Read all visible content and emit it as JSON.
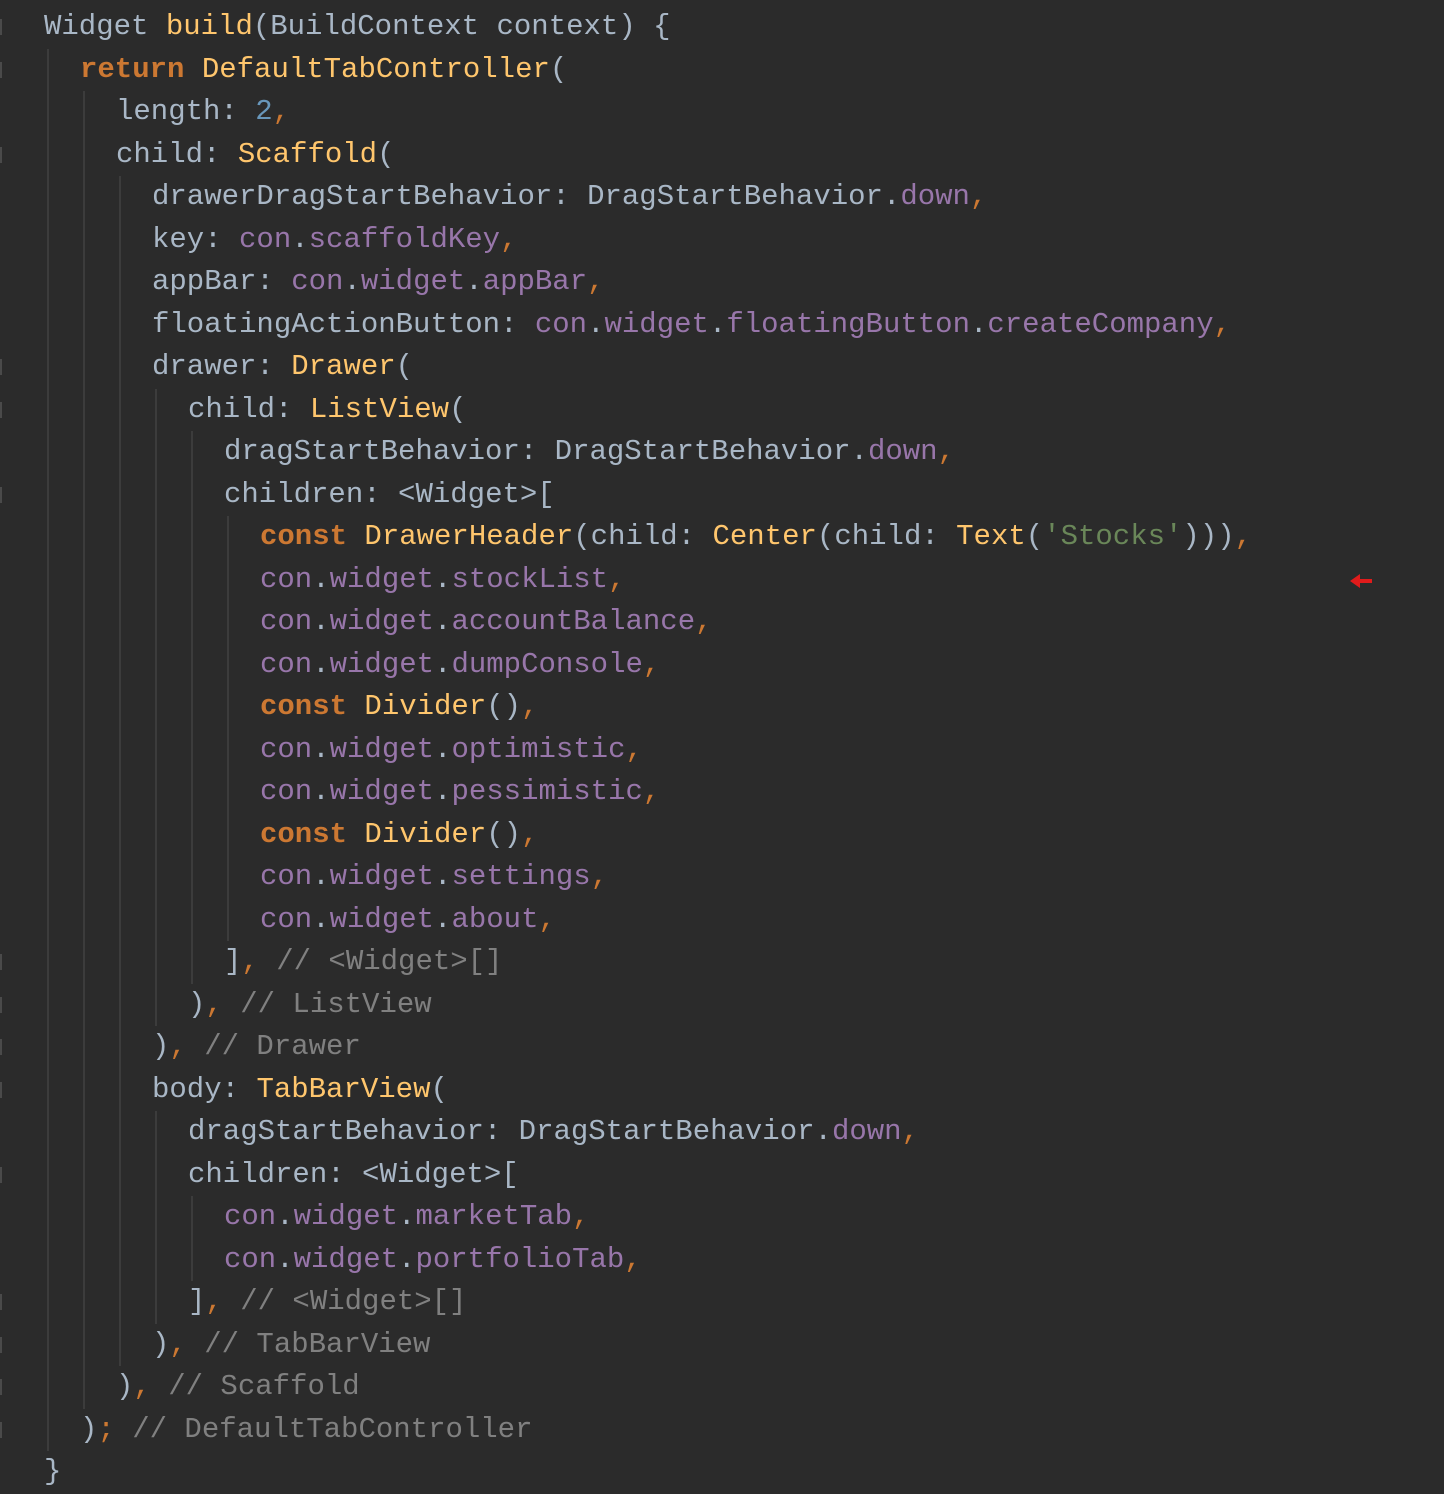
{
  "editor": {
    "language": "Dart",
    "theme_colors": {
      "background": "#2b2b2b",
      "keyword": "#cc7832",
      "function": "#ffc66d",
      "identifier": "#a9b7c6",
      "property": "#9876aa",
      "number": "#6897bb",
      "string": "#6a8759",
      "comment": "#808080"
    },
    "lines": [
      {
        "indent": 0,
        "tokens": [
          [
            "id",
            "Widget "
          ],
          [
            "fn",
            "build"
          ],
          [
            "punc",
            "("
          ],
          [
            "id",
            "BuildContext context"
          ],
          [
            "punc",
            ") {"
          ]
        ]
      },
      {
        "indent": 1,
        "tokens": [
          [
            "kw",
            "return "
          ],
          [
            "fn",
            "DefaultTabController"
          ],
          [
            "punc",
            "("
          ]
        ]
      },
      {
        "indent": 2,
        "tokens": [
          [
            "id",
            "length"
          ],
          [
            "punc",
            ": "
          ],
          [
            "num",
            "2"
          ],
          [
            "comma",
            ","
          ]
        ]
      },
      {
        "indent": 2,
        "tokens": [
          [
            "id",
            "child"
          ],
          [
            "punc",
            ": "
          ],
          [
            "fn",
            "Scaffold"
          ],
          [
            "punc",
            "("
          ]
        ]
      },
      {
        "indent": 3,
        "tokens": [
          [
            "id",
            "drawerDragStartBehavior"
          ],
          [
            "punc",
            ": "
          ],
          [
            "id",
            "DragStartBehavior"
          ],
          [
            "punc",
            "."
          ],
          [
            "prop",
            "down"
          ],
          [
            "comma",
            ","
          ]
        ]
      },
      {
        "indent": 3,
        "tokens": [
          [
            "id",
            "key"
          ],
          [
            "punc",
            ": "
          ],
          [
            "prop",
            "con"
          ],
          [
            "punc",
            "."
          ],
          [
            "prop",
            "scaffoldKey"
          ],
          [
            "comma",
            ","
          ]
        ]
      },
      {
        "indent": 3,
        "tokens": [
          [
            "id",
            "appBar"
          ],
          [
            "punc",
            ": "
          ],
          [
            "prop",
            "con"
          ],
          [
            "punc",
            "."
          ],
          [
            "prop",
            "widget"
          ],
          [
            "punc",
            "."
          ],
          [
            "prop",
            "appBar"
          ],
          [
            "comma",
            ","
          ]
        ]
      },
      {
        "indent": 3,
        "tokens": [
          [
            "id",
            "floatingActionButton"
          ],
          [
            "punc",
            ": "
          ],
          [
            "prop",
            "con"
          ],
          [
            "punc",
            "."
          ],
          [
            "prop",
            "widget"
          ],
          [
            "punc",
            "."
          ],
          [
            "prop",
            "floatingButton"
          ],
          [
            "punc",
            "."
          ],
          [
            "prop",
            "createCompany"
          ],
          [
            "comma",
            ","
          ]
        ]
      },
      {
        "indent": 3,
        "tokens": [
          [
            "id",
            "drawer"
          ],
          [
            "punc",
            ": "
          ],
          [
            "fn",
            "Drawer"
          ],
          [
            "punc",
            "("
          ]
        ]
      },
      {
        "indent": 4,
        "tokens": [
          [
            "id",
            "child"
          ],
          [
            "punc",
            ": "
          ],
          [
            "fn",
            "ListView"
          ],
          [
            "punc",
            "("
          ]
        ]
      },
      {
        "indent": 5,
        "tokens": [
          [
            "id",
            "dragStartBehavior"
          ],
          [
            "punc",
            ": "
          ],
          [
            "id",
            "DragStartBehavior"
          ],
          [
            "punc",
            "."
          ],
          [
            "prop",
            "down"
          ],
          [
            "comma",
            ","
          ]
        ]
      },
      {
        "indent": 5,
        "tokens": [
          [
            "id",
            "children"
          ],
          [
            "punc",
            ": <"
          ],
          [
            "id",
            "Widget"
          ],
          [
            "punc",
            ">["
          ]
        ]
      },
      {
        "indent": 6,
        "tokens": [
          [
            "kw",
            "const "
          ],
          [
            "fn",
            "DrawerHeader"
          ],
          [
            "punc",
            "("
          ],
          [
            "id",
            "child"
          ],
          [
            "punc",
            ": "
          ],
          [
            "fn",
            "Center"
          ],
          [
            "punc",
            "("
          ],
          [
            "id",
            "child"
          ],
          [
            "punc",
            ": "
          ],
          [
            "fn",
            "Text"
          ],
          [
            "punc",
            "("
          ],
          [
            "str",
            "'Stocks'"
          ],
          [
            "punc",
            ")))"
          ],
          [
            "comma",
            ","
          ]
        ]
      },
      {
        "indent": 6,
        "tokens": [
          [
            "prop",
            "con"
          ],
          [
            "punc",
            "."
          ],
          [
            "prop",
            "widget"
          ],
          [
            "punc",
            "."
          ],
          [
            "prop",
            "stockList"
          ],
          [
            "comma",
            ","
          ]
        ]
      },
      {
        "indent": 6,
        "tokens": [
          [
            "prop",
            "con"
          ],
          [
            "punc",
            "."
          ],
          [
            "prop",
            "widget"
          ],
          [
            "punc",
            "."
          ],
          [
            "prop",
            "accountBalance"
          ],
          [
            "comma",
            ","
          ]
        ]
      },
      {
        "indent": 6,
        "tokens": [
          [
            "prop",
            "con"
          ],
          [
            "punc",
            "."
          ],
          [
            "prop",
            "widget"
          ],
          [
            "punc",
            "."
          ],
          [
            "prop",
            "dumpConsole"
          ],
          [
            "comma",
            ","
          ]
        ]
      },
      {
        "indent": 6,
        "tokens": [
          [
            "kw",
            "const "
          ],
          [
            "fn",
            "Divider"
          ],
          [
            "punc",
            "()"
          ],
          [
            "comma",
            ","
          ]
        ]
      },
      {
        "indent": 6,
        "tokens": [
          [
            "prop",
            "con"
          ],
          [
            "punc",
            "."
          ],
          [
            "prop",
            "widget"
          ],
          [
            "punc",
            "."
          ],
          [
            "prop",
            "optimistic"
          ],
          [
            "comma",
            ","
          ]
        ]
      },
      {
        "indent": 6,
        "tokens": [
          [
            "prop",
            "con"
          ],
          [
            "punc",
            "."
          ],
          [
            "prop",
            "widget"
          ],
          [
            "punc",
            "."
          ],
          [
            "prop",
            "pessimistic"
          ],
          [
            "comma",
            ","
          ]
        ]
      },
      {
        "indent": 6,
        "tokens": [
          [
            "kw",
            "const "
          ],
          [
            "fn",
            "Divider"
          ],
          [
            "punc",
            "()"
          ],
          [
            "comma",
            ","
          ]
        ]
      },
      {
        "indent": 6,
        "tokens": [
          [
            "prop",
            "con"
          ],
          [
            "punc",
            "."
          ],
          [
            "prop",
            "widget"
          ],
          [
            "punc",
            "."
          ],
          [
            "prop",
            "settings"
          ],
          [
            "comma",
            ","
          ]
        ]
      },
      {
        "indent": 6,
        "tokens": [
          [
            "prop",
            "con"
          ],
          [
            "punc",
            "."
          ],
          [
            "prop",
            "widget"
          ],
          [
            "punc",
            "."
          ],
          [
            "prop",
            "about"
          ],
          [
            "comma",
            ","
          ]
        ]
      },
      {
        "indent": 5,
        "tokens": [
          [
            "punc",
            "]"
          ],
          [
            "comma",
            ","
          ],
          [
            "cmt",
            " // <Widget>[]"
          ]
        ]
      },
      {
        "indent": 4,
        "tokens": [
          [
            "punc",
            ")"
          ],
          [
            "comma",
            ","
          ],
          [
            "cmt",
            " // ListView"
          ]
        ]
      },
      {
        "indent": 3,
        "tokens": [
          [
            "punc",
            ")"
          ],
          [
            "comma",
            ","
          ],
          [
            "cmt",
            " // Drawer"
          ]
        ]
      },
      {
        "indent": 3,
        "tokens": [
          [
            "id",
            "body"
          ],
          [
            "punc",
            ": "
          ],
          [
            "fn",
            "TabBarView"
          ],
          [
            "punc",
            "("
          ]
        ]
      },
      {
        "indent": 4,
        "tokens": [
          [
            "id",
            "dragStartBehavior"
          ],
          [
            "punc",
            ": "
          ],
          [
            "id",
            "DragStartBehavior"
          ],
          [
            "punc",
            "."
          ],
          [
            "prop",
            "down"
          ],
          [
            "comma",
            ","
          ]
        ]
      },
      {
        "indent": 4,
        "tokens": [
          [
            "id",
            "children"
          ],
          [
            "punc",
            ": <"
          ],
          [
            "id",
            "Widget"
          ],
          [
            "punc",
            ">["
          ]
        ]
      },
      {
        "indent": 5,
        "tokens": [
          [
            "prop",
            "con"
          ],
          [
            "punc",
            "."
          ],
          [
            "prop",
            "widget"
          ],
          [
            "punc",
            "."
          ],
          [
            "prop",
            "marketTab"
          ],
          [
            "comma",
            ","
          ]
        ]
      },
      {
        "indent": 5,
        "tokens": [
          [
            "prop",
            "con"
          ],
          [
            "punc",
            "."
          ],
          [
            "prop",
            "widget"
          ],
          [
            "punc",
            "."
          ],
          [
            "prop",
            "portfolioTab"
          ],
          [
            "comma",
            ","
          ]
        ]
      },
      {
        "indent": 4,
        "tokens": [
          [
            "punc",
            "]"
          ],
          [
            "comma",
            ","
          ],
          [
            "cmt",
            " // <Widget>[]"
          ]
        ]
      },
      {
        "indent": 3,
        "tokens": [
          [
            "punc",
            ")"
          ],
          [
            "comma",
            ","
          ],
          [
            "cmt",
            " // TabBarView"
          ]
        ]
      },
      {
        "indent": 2,
        "tokens": [
          [
            "punc",
            ")"
          ],
          [
            "comma",
            ","
          ],
          [
            "cmt",
            " // Scaffold"
          ]
        ]
      },
      {
        "indent": 1,
        "tokens": [
          [
            "punc",
            ")"
          ],
          [
            "comma",
            ";"
          ],
          [
            "cmt",
            " // DefaultTabController"
          ]
        ]
      },
      {
        "indent": 0,
        "tokens": [
          [
            "punc",
            "}"
          ]
        ]
      }
    ],
    "marker": {
      "icon": "red-arrow-left-icon",
      "line_index": 13,
      "color": "#e01b1b"
    }
  }
}
